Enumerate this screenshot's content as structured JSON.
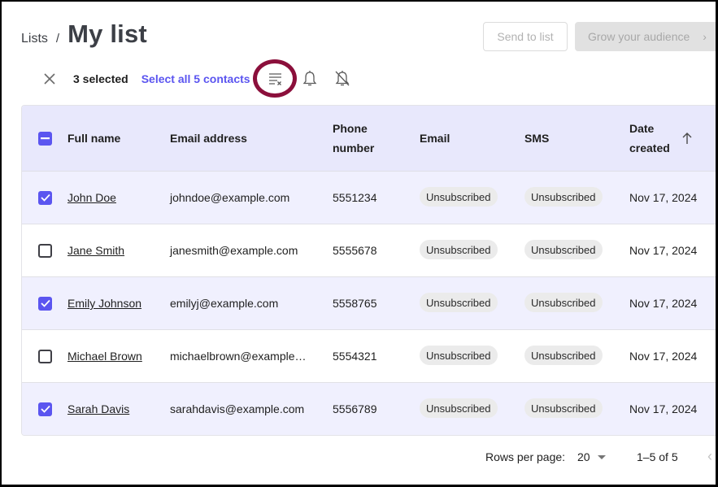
{
  "header": {
    "breadcrumb": "Lists",
    "separator": "/",
    "title": "My list"
  },
  "actions": {
    "send_to_list": "Send to list",
    "grow_audience": "Grow your audience",
    "grow_chevron": "›"
  },
  "toolbar": {
    "close_icon": "close-icon",
    "selected_label": "3 selected",
    "select_all_label": "Select all 5 contacts",
    "icons": [
      "clear-list-icon",
      "bell-icon",
      "bell-off-icon"
    ],
    "highlight_color": "#8b0f3b"
  },
  "table": {
    "columns": [
      "Full name",
      "Email address",
      "Phone number",
      "Email",
      "SMS",
      "Date created"
    ],
    "column_lines": {
      "phone": [
        "Phone",
        "number"
      ],
      "date": [
        "Date",
        "created"
      ]
    },
    "sort_icon": "arrow-up-icon",
    "header_checkbox": "indeterminate",
    "rows": [
      {
        "selected": true,
        "name": "John Doe",
        "email": "johndoe@example.com",
        "phone": "5551234",
        "email_status": "Unsubscribed",
        "sms_status": "Unsubscribed",
        "date": "Nov 17, 2024"
      },
      {
        "selected": false,
        "name": "Jane Smith",
        "email": "janesmith@example.com",
        "phone": "5555678",
        "email_status": "Unsubscribed",
        "sms_status": "Unsubscribed",
        "date": "Nov 17, 2024"
      },
      {
        "selected": true,
        "name": "Emily Johnson",
        "email": "emilyj@example.com",
        "phone": "5558765",
        "email_status": "Unsubscribed",
        "sms_status": "Unsubscribed",
        "date": "Nov 17, 2024"
      },
      {
        "selected": false,
        "name": "Michael Brown",
        "email": "michaelbrown@example…",
        "phone": "5554321",
        "email_status": "Unsubscribed",
        "sms_status": "Unsubscribed",
        "date": "Nov 17, 2024"
      },
      {
        "selected": true,
        "name": "Sarah Davis",
        "email": "sarahdavis@example.com",
        "phone": "5556789",
        "email_status": "Unsubscribed",
        "sms_status": "Unsubscribed",
        "date": "Nov 17, 2024"
      }
    ]
  },
  "pagination": {
    "rows_per_page_label": "Rows per page:",
    "rows_per_page_value": "20",
    "range": "1–5 of 5",
    "prev": "‹"
  },
  "colors": {
    "accent": "#5b55f0",
    "header_bg": "#e8e8fc",
    "selected_row_bg": "#f0f0fe",
    "chip_bg": "#ebebeb"
  }
}
